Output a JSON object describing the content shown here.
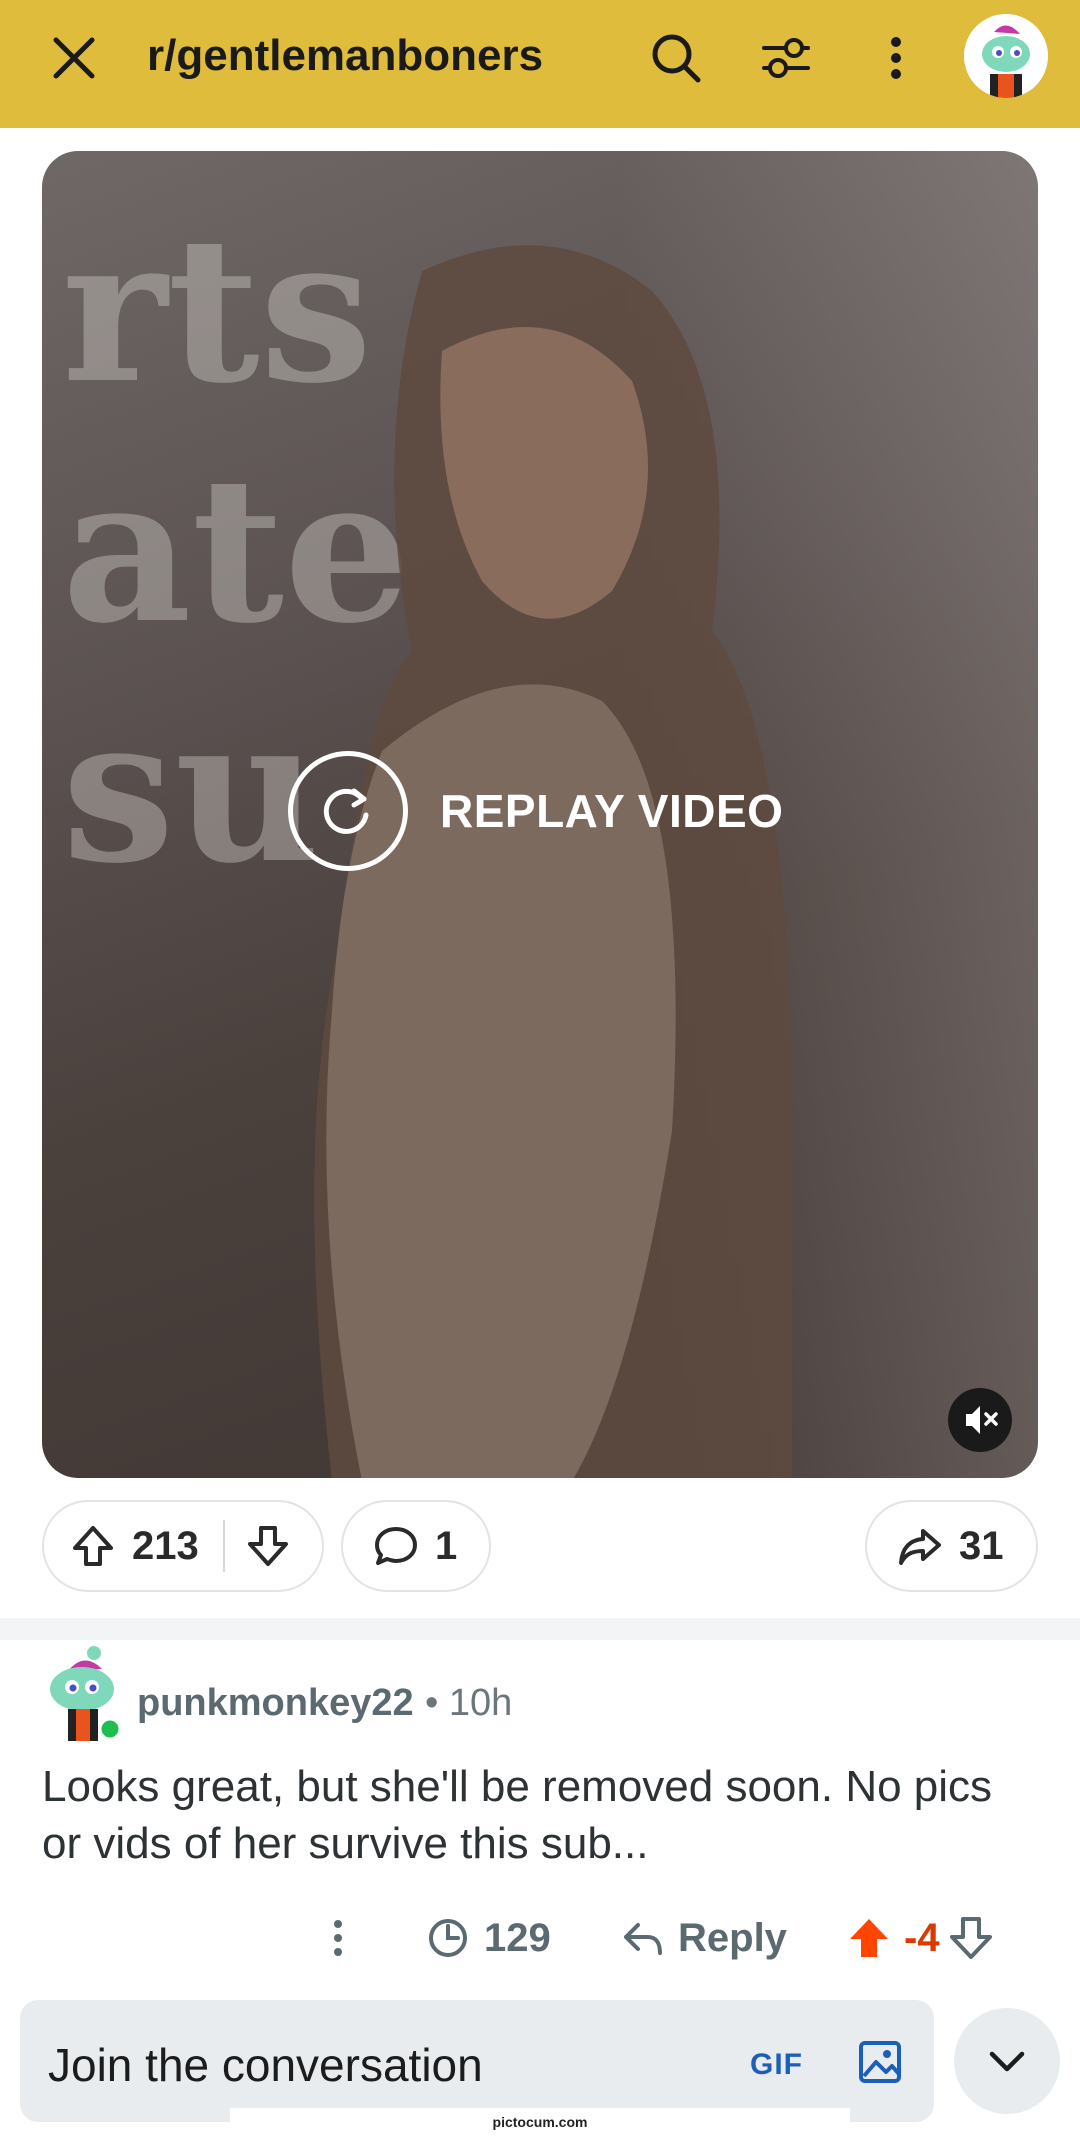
{
  "header": {
    "subreddit": "r/gentlemanboners",
    "close_icon": "close-icon",
    "search_icon": "search-icon",
    "filter_icon": "filter-icon",
    "more_icon": "more-vertical-icon",
    "bg_color": "#dfbc3b"
  },
  "media": {
    "replay_label": "REPLAY VIDEO",
    "mute_icon": "muted-speaker-icon"
  },
  "post_actions": {
    "upvotes": "213",
    "comments": "1",
    "shares": "31"
  },
  "comment": {
    "username": "punkmonkey22",
    "separator": "•",
    "time": "10h",
    "body": "Looks great, but she'll be removed soon. No pics or vids of her survive this sub...",
    "award_count": "129",
    "reply_label": "Reply",
    "score": "-4",
    "upvote_color": "#ff4500",
    "score_color": "#d93a00"
  },
  "composer": {
    "placeholder": "Join the conversation",
    "gif_label": "GIF"
  },
  "watermark": "pictocum.com"
}
